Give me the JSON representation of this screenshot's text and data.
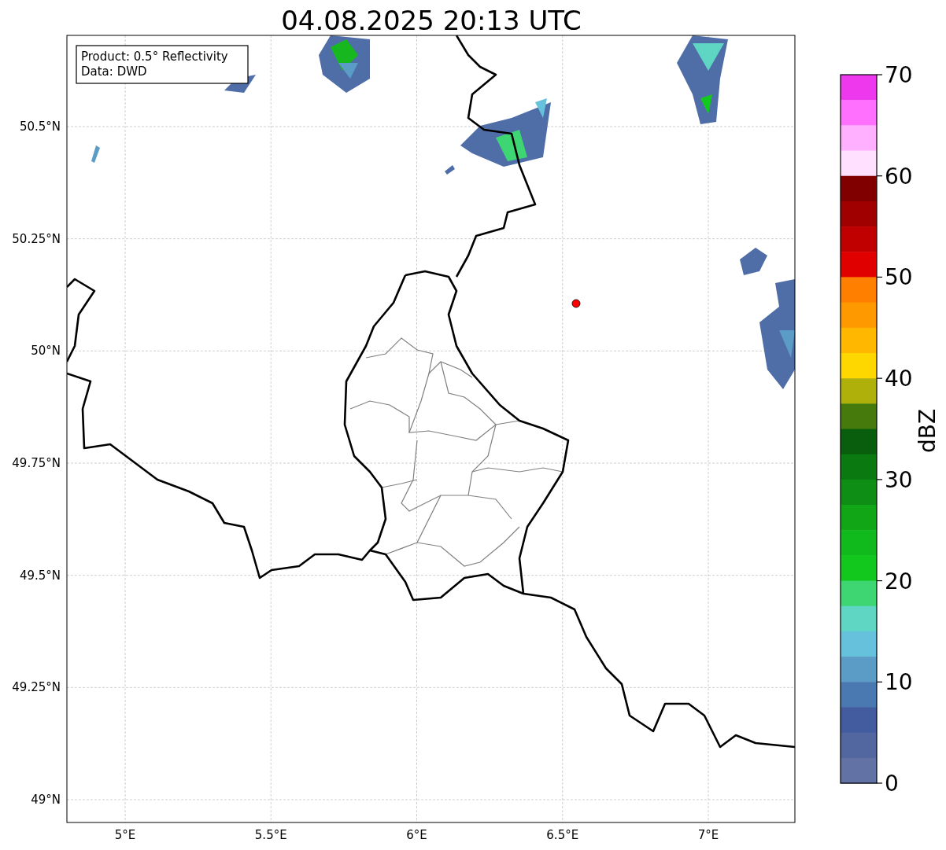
{
  "title": "04.08.2025 20:13 UTC",
  "info_box": {
    "lines": [
      "Product: 0.5° Reflectivity",
      "Data: DWD"
    ]
  },
  "map": {
    "lat_ticks": [
      "50.5°N",
      "50.25°N",
      "50°N",
      "49.75°N",
      "49.5°N",
      "49.25°N",
      "49°N"
    ],
    "lon_ticks": [
      "5°E",
      "5.5°E",
      "6°E",
      "6.5°E",
      "7°E"
    ]
  },
  "colorbar": {
    "label": "dBZ",
    "ticks": [
      "70",
      "60",
      "50",
      "40",
      "30",
      "20",
      "10",
      "0"
    ],
    "bins": [
      {
        "color": "#ee38ee"
      },
      {
        "color": "#ff70ff"
      },
      {
        "color": "#ffb0ff"
      },
      {
        "color": "#ffe0ff"
      },
      {
        "color": "#800000"
      },
      {
        "color": "#a00000"
      },
      {
        "color": "#c00000"
      },
      {
        "color": "#e00000"
      },
      {
        "color": "#ff7f00"
      },
      {
        "color": "#ff9900"
      },
      {
        "color": "#ffb700"
      },
      {
        "color": "#ffd700"
      },
      {
        "color": "#b0b00b"
      },
      {
        "color": "#477a0c"
      },
      {
        "color": "#085e0c"
      },
      {
        "color": "#0a7a10"
      },
      {
        "color": "#0e8e14"
      },
      {
        "color": "#11a616"
      },
      {
        "color": "#10b91c"
      },
      {
        "color": "#12c81c"
      },
      {
        "color": "#3dd673"
      },
      {
        "color": "#5fd6c4"
      },
      {
        "color": "#66c1dd"
      },
      {
        "color": "#5b9cc6"
      },
      {
        "color": "#4a78b0"
      },
      {
        "color": "#435c9f"
      },
      {
        "color": "#52669f"
      },
      {
        "color": "#6272a4"
      }
    ]
  }
}
